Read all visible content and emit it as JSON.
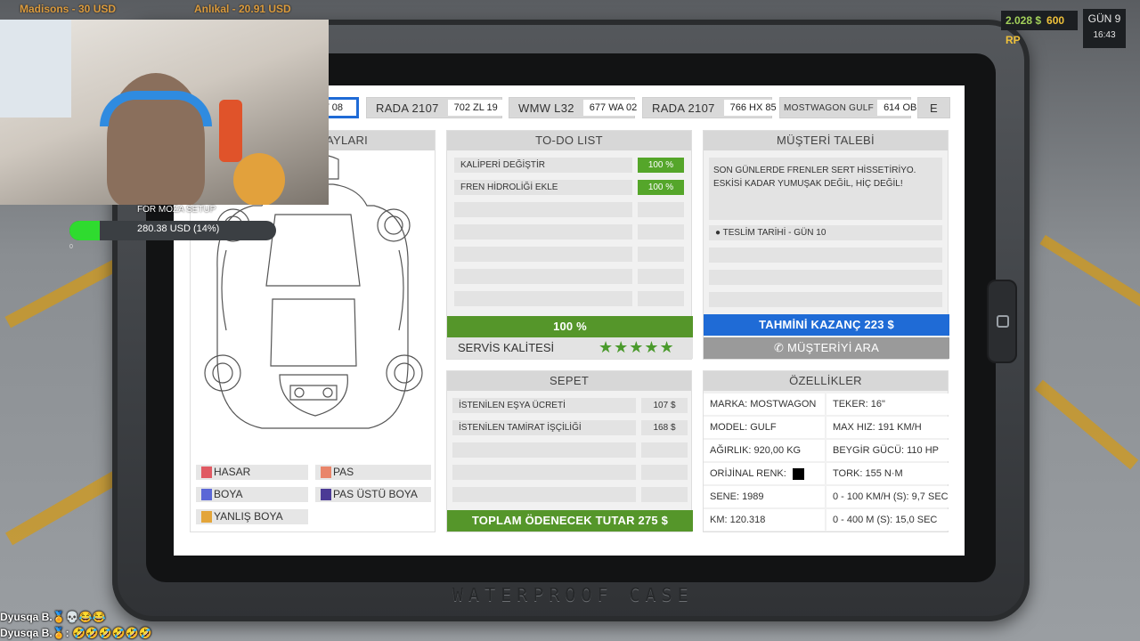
{
  "hud": {
    "money": "2.028 $",
    "rp": "600 RP",
    "day": "GÜN 9",
    "time": "16:43"
  },
  "ticker": {
    "left": "Madisons - 30 USD",
    "right": "Anlıkal - 20.91 USD"
  },
  "tabs": [
    {
      "name": "",
      "plate": "EV 08",
      "active": true
    },
    {
      "name": "RADA 2107",
      "plate": "702 ZL 19"
    },
    {
      "name": "WMW L32",
      "plate": "677 WA 02"
    },
    {
      "name": "RADA 2107",
      "plate": "766 HX 85"
    },
    {
      "name": "MOSTWAGON GULF",
      "plate": "614 OB 71"
    },
    {
      "name": "E",
      "plate": ""
    }
  ],
  "parts_panel": {
    "title": "AYLARI",
    "legend": [
      {
        "label": "HASAR",
        "color": "#e05a63"
      },
      {
        "label": "PAS",
        "color": "#e9856a"
      },
      {
        "label": "BOYA",
        "color": "#5b67d6"
      },
      {
        "label": "PAS ÜSTÜ BOYA",
        "color": "#4b3a95"
      },
      {
        "label": "YANLIŞ BOYA",
        "color": "#e3a53a"
      }
    ]
  },
  "todo": {
    "title": "TO-DO LIST",
    "items": [
      {
        "label": "KALİPERİ DEĞİŞTİR",
        "value": "100 %"
      },
      {
        "label": "FREN HİDROLİĞİ EKLE",
        "value": "100 %"
      }
    ],
    "progress": "100 %",
    "quality_label": "SERVİS KALİTESİ",
    "stars": 5
  },
  "customer": {
    "title": "MÜŞTERİ TALEBİ",
    "request": "SON GÜNLERDE FRENLER SERT HİSSETİRİYO. ESKİSİ KADAR YUMUŞAK DEĞİL, HİÇ DEĞİL!",
    "deadline": "TESLİM TARİHİ - GÜN 10",
    "earnings": "TAHMİNİ KAZANÇ 223 $",
    "call": "MÜŞTERİYİ ARA"
  },
  "cart": {
    "title": "SEPET",
    "items": [
      {
        "label": "İSTENİLEN EŞYA ÜCRETİ",
        "value": "107 $"
      },
      {
        "label": "İSTENİLEN TAMİRAT İŞÇİLİĞİ",
        "value": "168 $"
      }
    ],
    "total": "TOPLAM ÖDENECEK TUTAR 275 $"
  },
  "specs": {
    "title": "ÖZELLİKLER",
    "left": [
      "MARKA:  MOSTWAGON",
      "MODEL:  GULF",
      "AĞIRLIK:  920,00 KG",
      "ORİJİNAL RENK:",
      "SENE:  1989",
      "KM:  120.318"
    ],
    "right": [
      "TEKER:  16\"",
      "MAX HIZ:  191 KM/H",
      "BEYGİR GÜCÜ:  110 HP",
      "TORK:  155 N·M",
      "0 - 100 KM/H (S):  9,7 SEC",
      "0 - 400 M (S):  15,0 SEC"
    ],
    "original_color": "#000000"
  },
  "case_label": "WATERPROOF CASE",
  "goal": {
    "label": "FOR MOZA SETUP",
    "amount": "280.38 USD (14%)",
    "progress": 0.14,
    "zero": "0"
  },
  "chat": [
    {
      "text": "Dyusqa B.🏅💀😂😂"
    },
    {
      "text": "Dyusqa B.🏅: 🤣🤣🤣🤣🤣🤣"
    }
  ]
}
